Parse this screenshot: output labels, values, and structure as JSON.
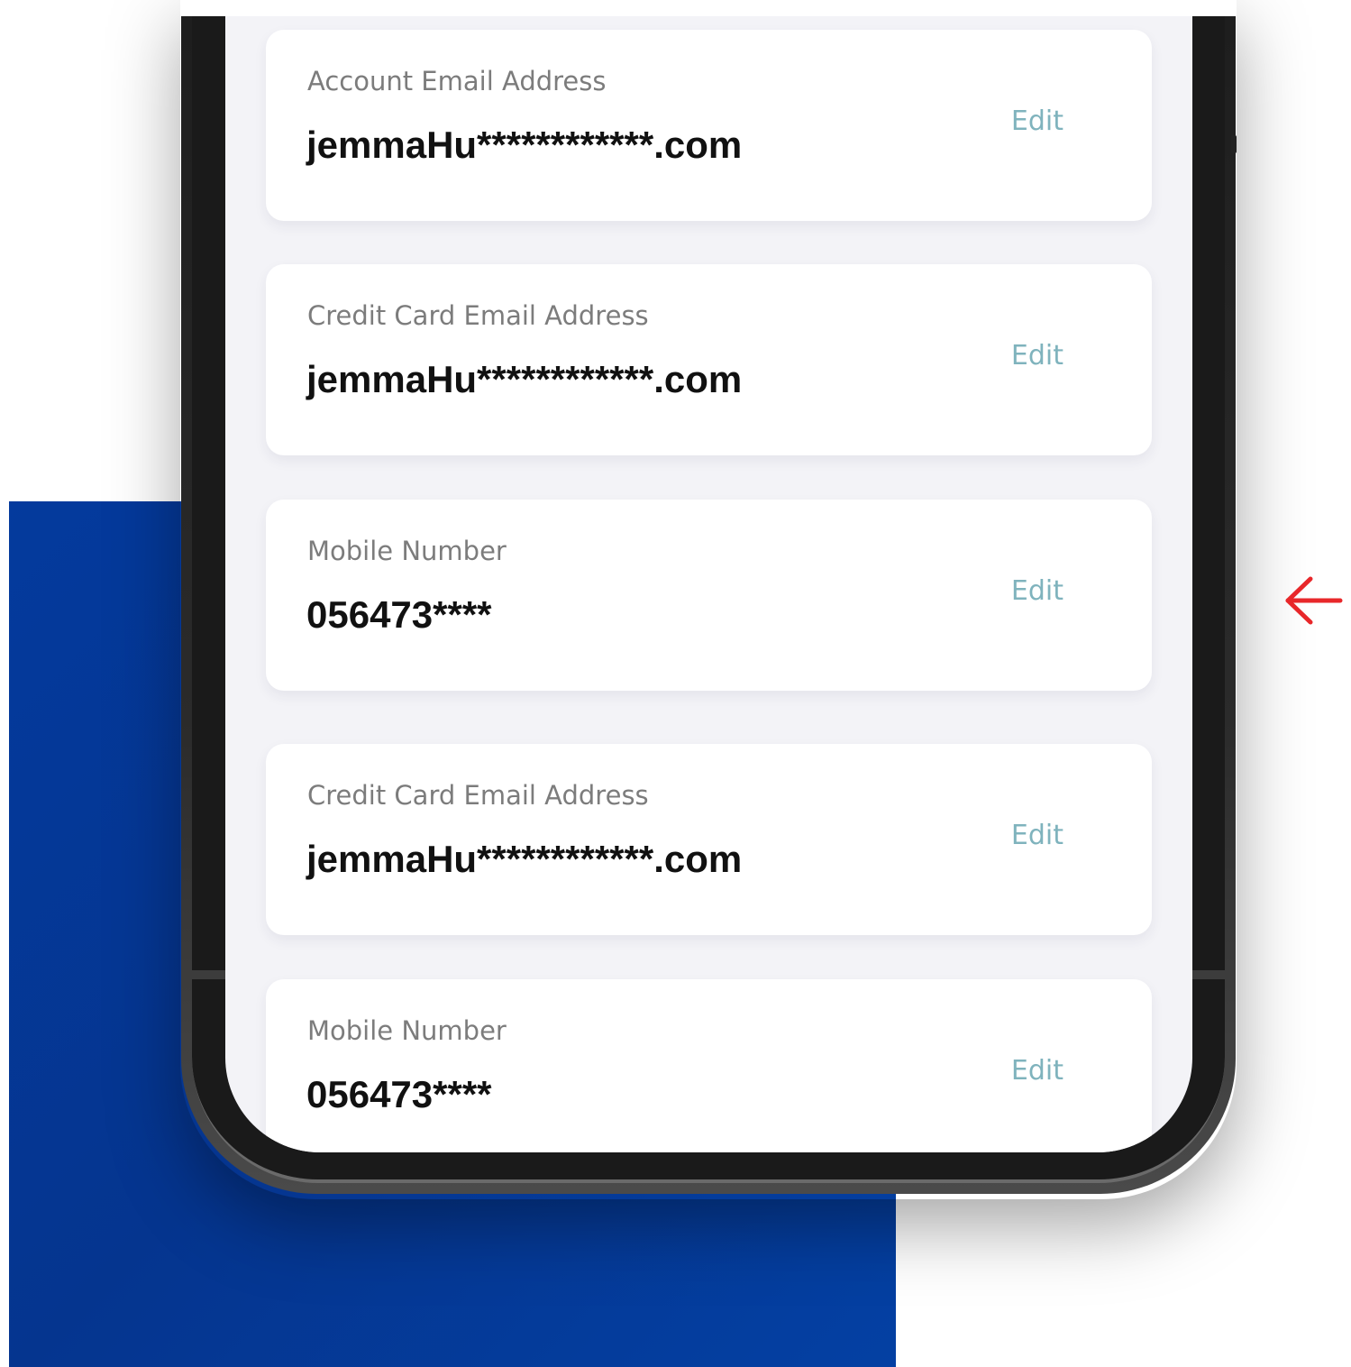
{
  "colors": {
    "background_block": "#043a9d",
    "label": "#7c7c7c",
    "value": "#111111",
    "edit_link": "#7fb3bd",
    "arrow": "#e8272a",
    "screen_bg": "#f3f3f7"
  },
  "icons": {
    "back": "left-arrow-icon"
  },
  "cards": [
    {
      "label": "Account Email Address",
      "value": "jemmaHu************.com",
      "action": "Edit"
    },
    {
      "label": "Credit Card Email Address",
      "value": "jemmaHu************.com",
      "action": "Edit"
    },
    {
      "label": "Mobile Number",
      "value": "056473****",
      "action": "Edit"
    },
    {
      "label": "Credit Card Email Address",
      "value": "jemmaHu************.com",
      "action": "Edit"
    },
    {
      "label": "Mobile Number",
      "value": "056473****",
      "action": "Edit"
    }
  ]
}
